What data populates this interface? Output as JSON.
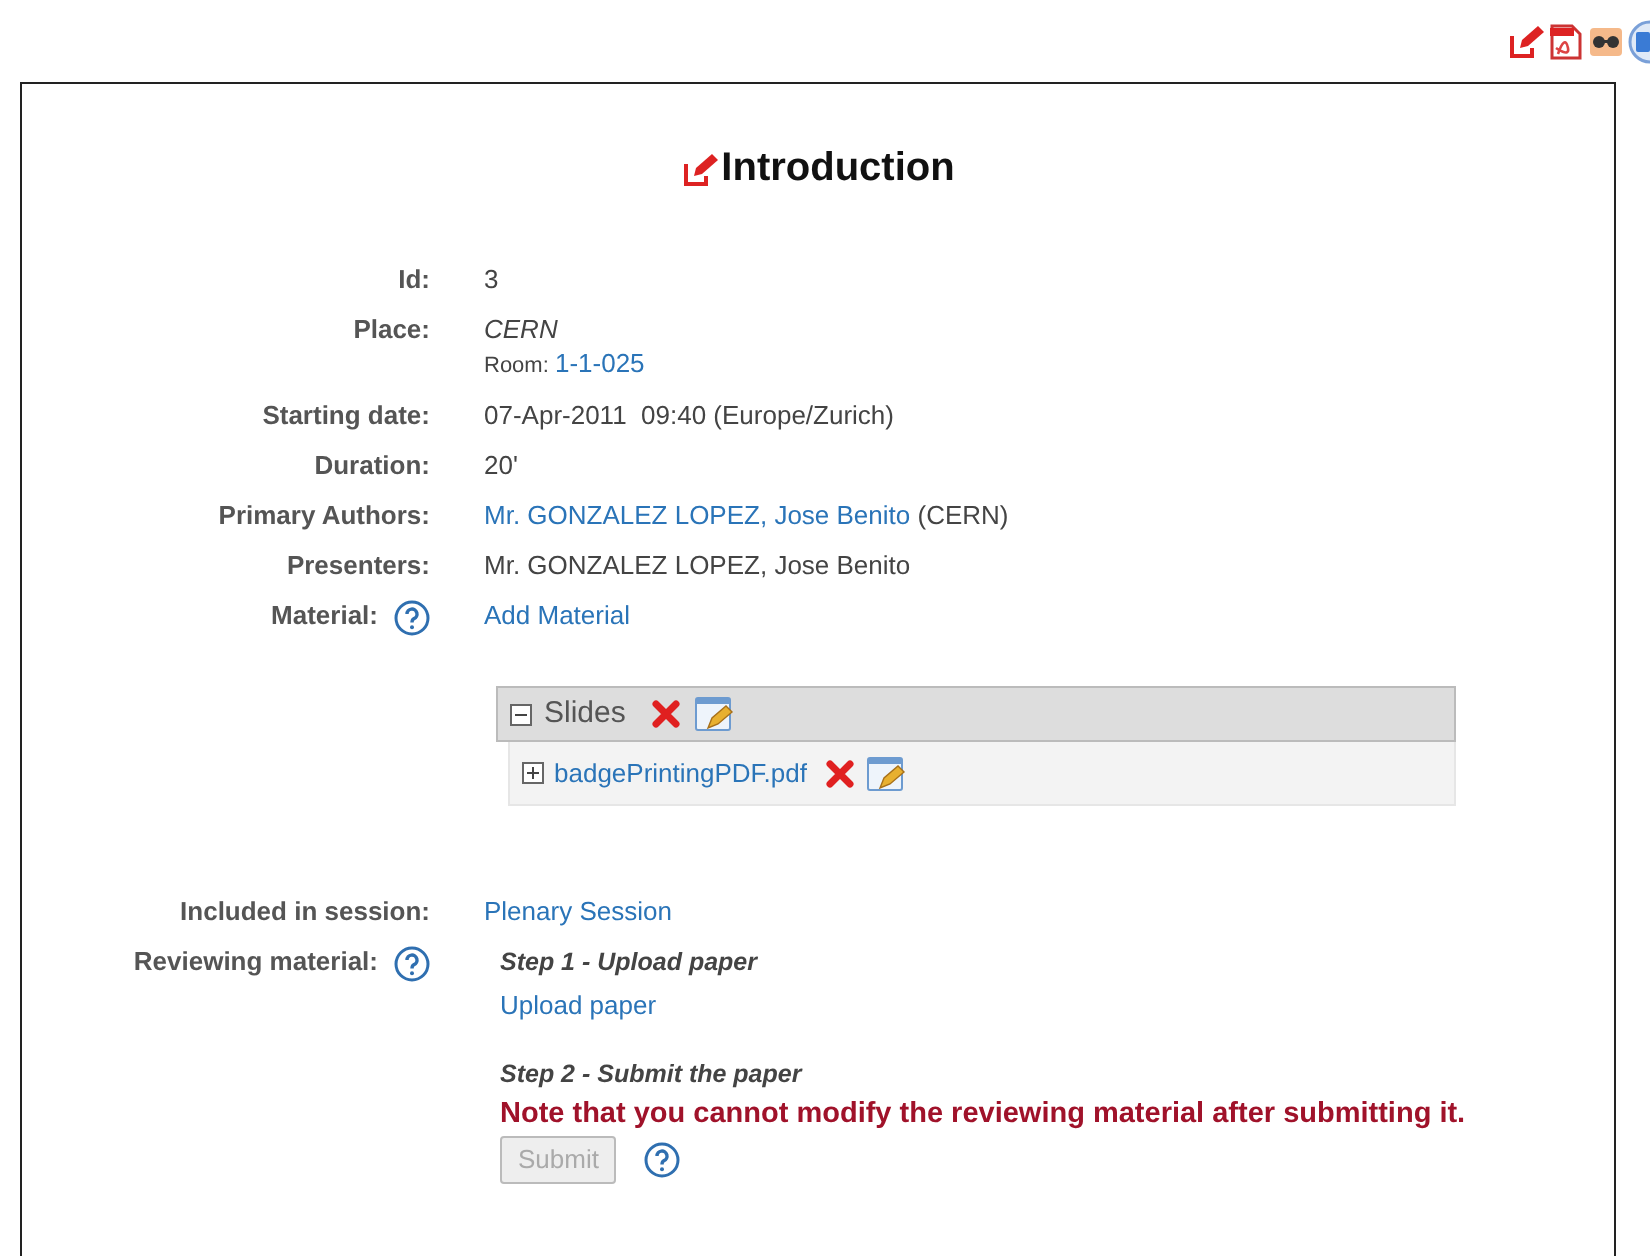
{
  "title": "Introduction",
  "fields": [
    {
      "kind": "text",
      "label": "Id:",
      "help": false,
      "value": "3"
    },
    {
      "kind": "place",
      "label": "Place:",
      "help": false,
      "value": "CERN",
      "room_label": "Room:",
      "room": "1-1-025"
    },
    {
      "kind": "text",
      "label": "Starting date:",
      "help": false,
      "value": "07-Apr-2011  09:40 (Europe/Zurich)"
    },
    {
      "kind": "text",
      "label": "Duration:",
      "help": false,
      "value": "20'"
    },
    {
      "kind": "author",
      "label": "Primary Authors:",
      "help": false,
      "link": "Mr. GONZALEZ LOPEZ, Jose Benito",
      "note": "(CERN)"
    },
    {
      "kind": "text",
      "label": "Presenters:",
      "help": false,
      "value": "Mr. GONZALEZ LOPEZ, Jose Benito"
    },
    {
      "kind": "link",
      "label": "Material:",
      "help": true,
      "link": "Add Material"
    },
    {
      "kind": "materials",
      "items": [
        {
          "name": "Slides",
          "expanded": true,
          "files": [
            {
              "name": "badgePrintingPDF.pdf",
              "expanded": false
            }
          ]
        }
      ]
    },
    {
      "kind": "link",
      "label": "Included in session:",
      "help": false,
      "link": "Plenary Session"
    },
    {
      "kind": "review",
      "label": "Reviewing material:",
      "help": true,
      "step1": "Step 1 - Upload paper",
      "upload": "Upload paper",
      "step2": "Step 2 - Submit the paper",
      "note": "Note that you cannot modify the reviewing material after submitting it.",
      "submit": {
        "label": "Submit",
        "disabled": true
      }
    }
  ]
}
